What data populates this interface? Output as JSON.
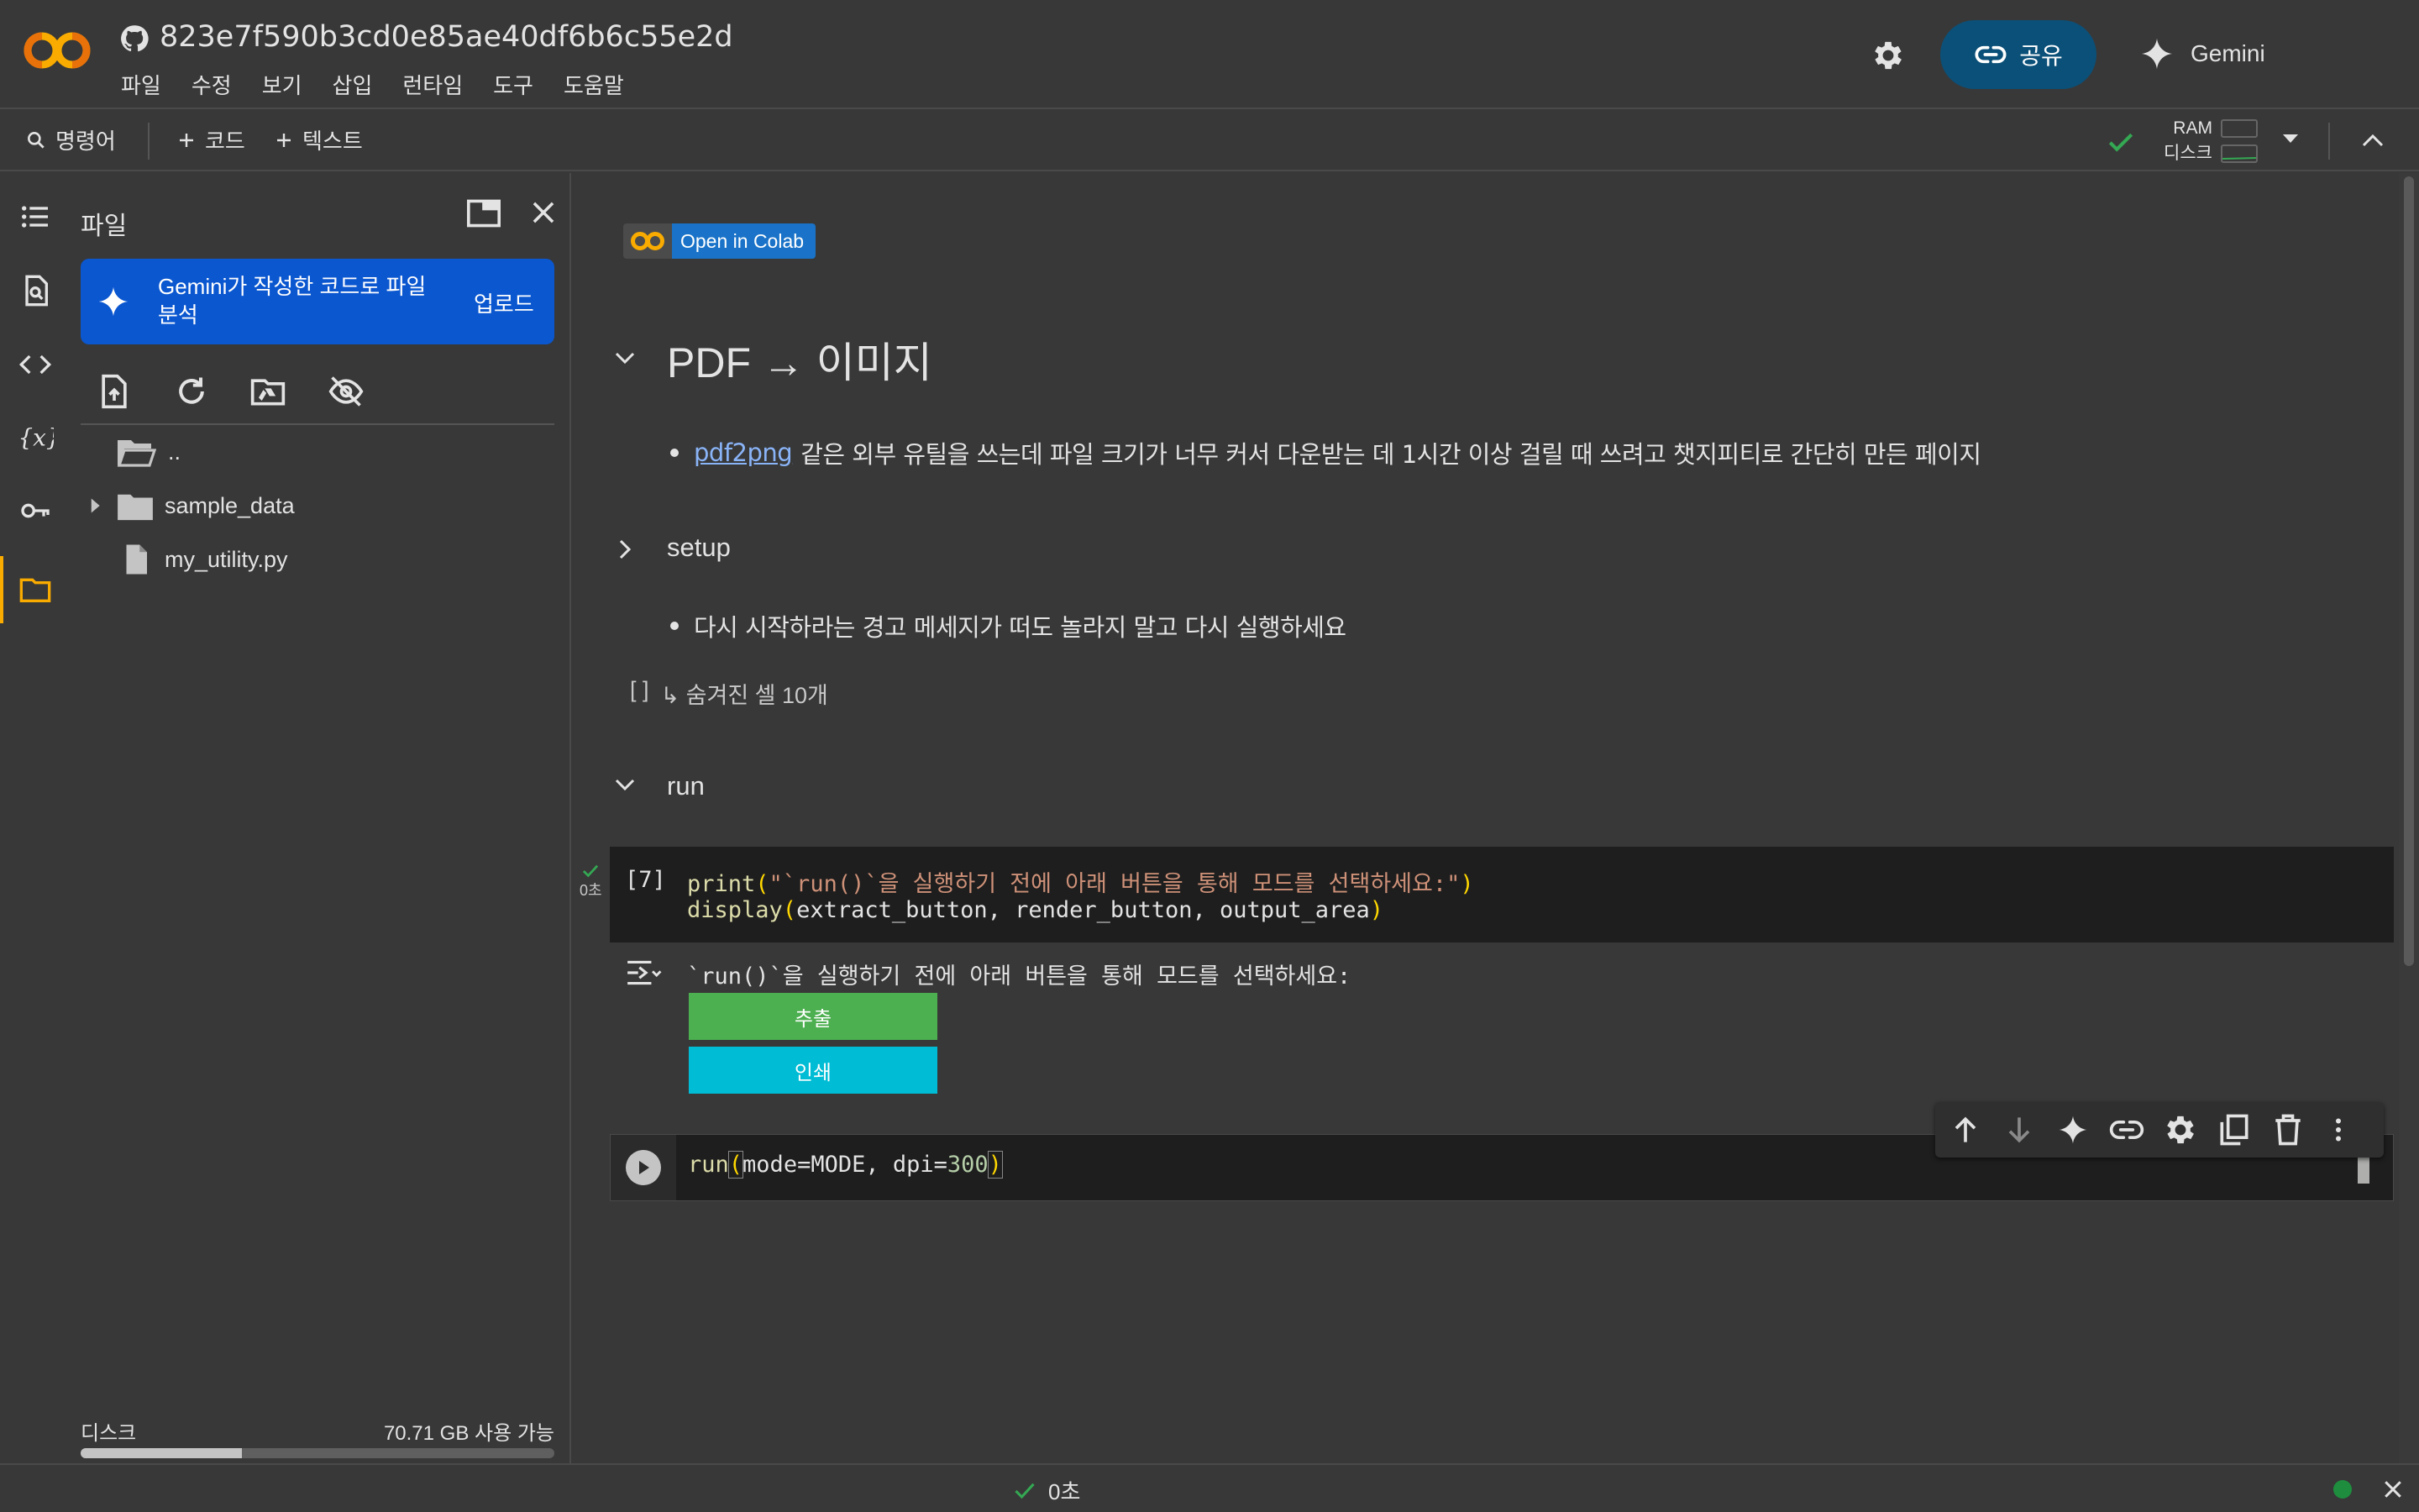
{
  "app": {
    "notebook_title": "823e7f590b3cd0e85ae40df6b6c55e2d",
    "menu": [
      "파일",
      "수정",
      "보기",
      "삽입",
      "런타임",
      "도구",
      "도움말"
    ],
    "share_label": "공유",
    "gemini_label": "Gemini"
  },
  "toolbar": {
    "command_label": "명령어",
    "add_code_label": "코드",
    "add_text_label": "텍스트",
    "ram_label": "RAM",
    "disk_label": "디스크"
  },
  "filepanel": {
    "title": "파일",
    "gemini_card_text": "Gemini가 작성한 코드로 파일 분석",
    "gemini_card_action": "업로드",
    "items": [
      {
        "name": "..",
        "type": "folder-open"
      },
      {
        "name": "sample_data",
        "type": "folder"
      },
      {
        "name": "my_utility.py",
        "type": "file"
      }
    ],
    "disk_label": "디스크",
    "disk_value": "70.71 GB 사용 가능",
    "disk_used_fraction": 0.34
  },
  "notebook": {
    "colab_badge": "Open in Colab",
    "heading_pdf": "PDF → 이미지",
    "bullet1_link": "pdf2png",
    "bullet1_text": "같은 외부 유틸을 쓰는데 파일 크기가 너무 커서 다운받는 데 1시간 이상 걸릴 때 쓰려고 챗지피티로 간단히 만든 페이지",
    "heading_setup": "setup",
    "bullet2_text": "다시 시작하라는 경고 메세지가 떠도 놀라지 말고 다시 실행하세요",
    "hidden_cells_brackets": "[ ]",
    "hidden_cells_text": "↳ 숨겨진 셀 10개",
    "heading_run": "run",
    "cell1": {
      "exec_count": "[7]",
      "exec_time": "0초",
      "line1_fn": "print",
      "line1_str": "\"`run()`을 실행하기 전에 아래 버튼을 통해 모드를 선택하세요:\"",
      "line2_fn": "display",
      "line2_args": "extract_button, render_button, output_area",
      "output_text": "`run()`을 실행하기 전에 아래 버튼을 통해 모드를 선택하세요:",
      "extract_button": "추출",
      "render_button": "인쇄"
    },
    "cell2": {
      "fn": "run",
      "arg1": "mode=MODE, dpi=",
      "arg_num": "300"
    }
  },
  "statusbar": {
    "time": "0초"
  },
  "colors": {
    "accent_orange": "#f9ab00",
    "share_bg": "#0b5078",
    "gemini_card_bg": "#0b57d0",
    "extract_btn": "#4caf50",
    "render_btn": "#00bcd4",
    "ok_green": "#1e8e3e"
  }
}
